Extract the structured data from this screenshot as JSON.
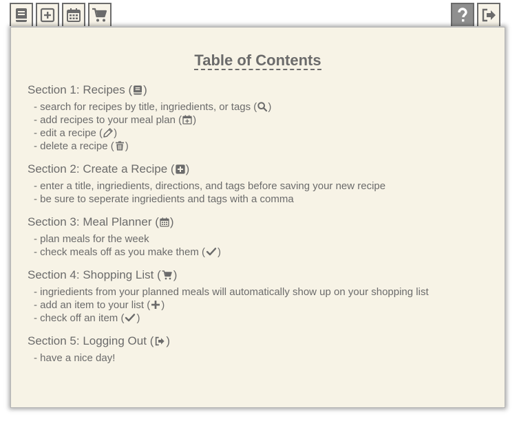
{
  "toolbar": {
    "left_icons": [
      "recipe-book-icon",
      "add-recipe-icon",
      "calendar-icon",
      "shopping-cart-icon"
    ],
    "right_icons": [
      "help-icon",
      "logout-icon"
    ]
  },
  "toc": {
    "title": "Table of Contents",
    "sections": [
      {
        "heading": "Section 1: Recipes",
        "icon": "book-icon",
        "items": [
          {
            "text": "- search for recipes by title, ingriedients, or tags",
            "icon": "search-icon"
          },
          {
            "text": "- add recipes to your meal plan",
            "icon": "calendar-plus-icon"
          },
          {
            "text": "- edit a recipe",
            "icon": "pencil-icon"
          },
          {
            "text": "- delete a recipe",
            "icon": "trash-icon"
          }
        ]
      },
      {
        "heading": "Section 2: Create a Recipe",
        "icon": "plus-square-icon",
        "items": [
          {
            "text": "- enter a title, ingriedients, directions, and tags before saving your new recipe"
          },
          {
            "text": "- be sure to seperate ingriedients and tags with a comma"
          }
        ]
      },
      {
        "heading": "Section 3: Meal Planner",
        "icon": "calendar-icon",
        "items": [
          {
            "text": "- plan meals for the week"
          },
          {
            "text": "- check meals off as you make them",
            "icon": "check-icon"
          }
        ]
      },
      {
        "heading": "Section 4: Shopping List",
        "icon": "cart-icon",
        "items": [
          {
            "text": "- ingriedients from your planned meals will automatically show up on your shopping list"
          },
          {
            "text": "- add an item to your list",
            "icon": "plus-icon"
          },
          {
            "text": "- check off an item",
            "icon": "check-icon"
          }
        ]
      },
      {
        "heading": "Section 5: Logging Out",
        "icon": "sign-out-icon",
        "items": [
          {
            "text": "- have a nice day!"
          }
        ]
      }
    ]
  }
}
